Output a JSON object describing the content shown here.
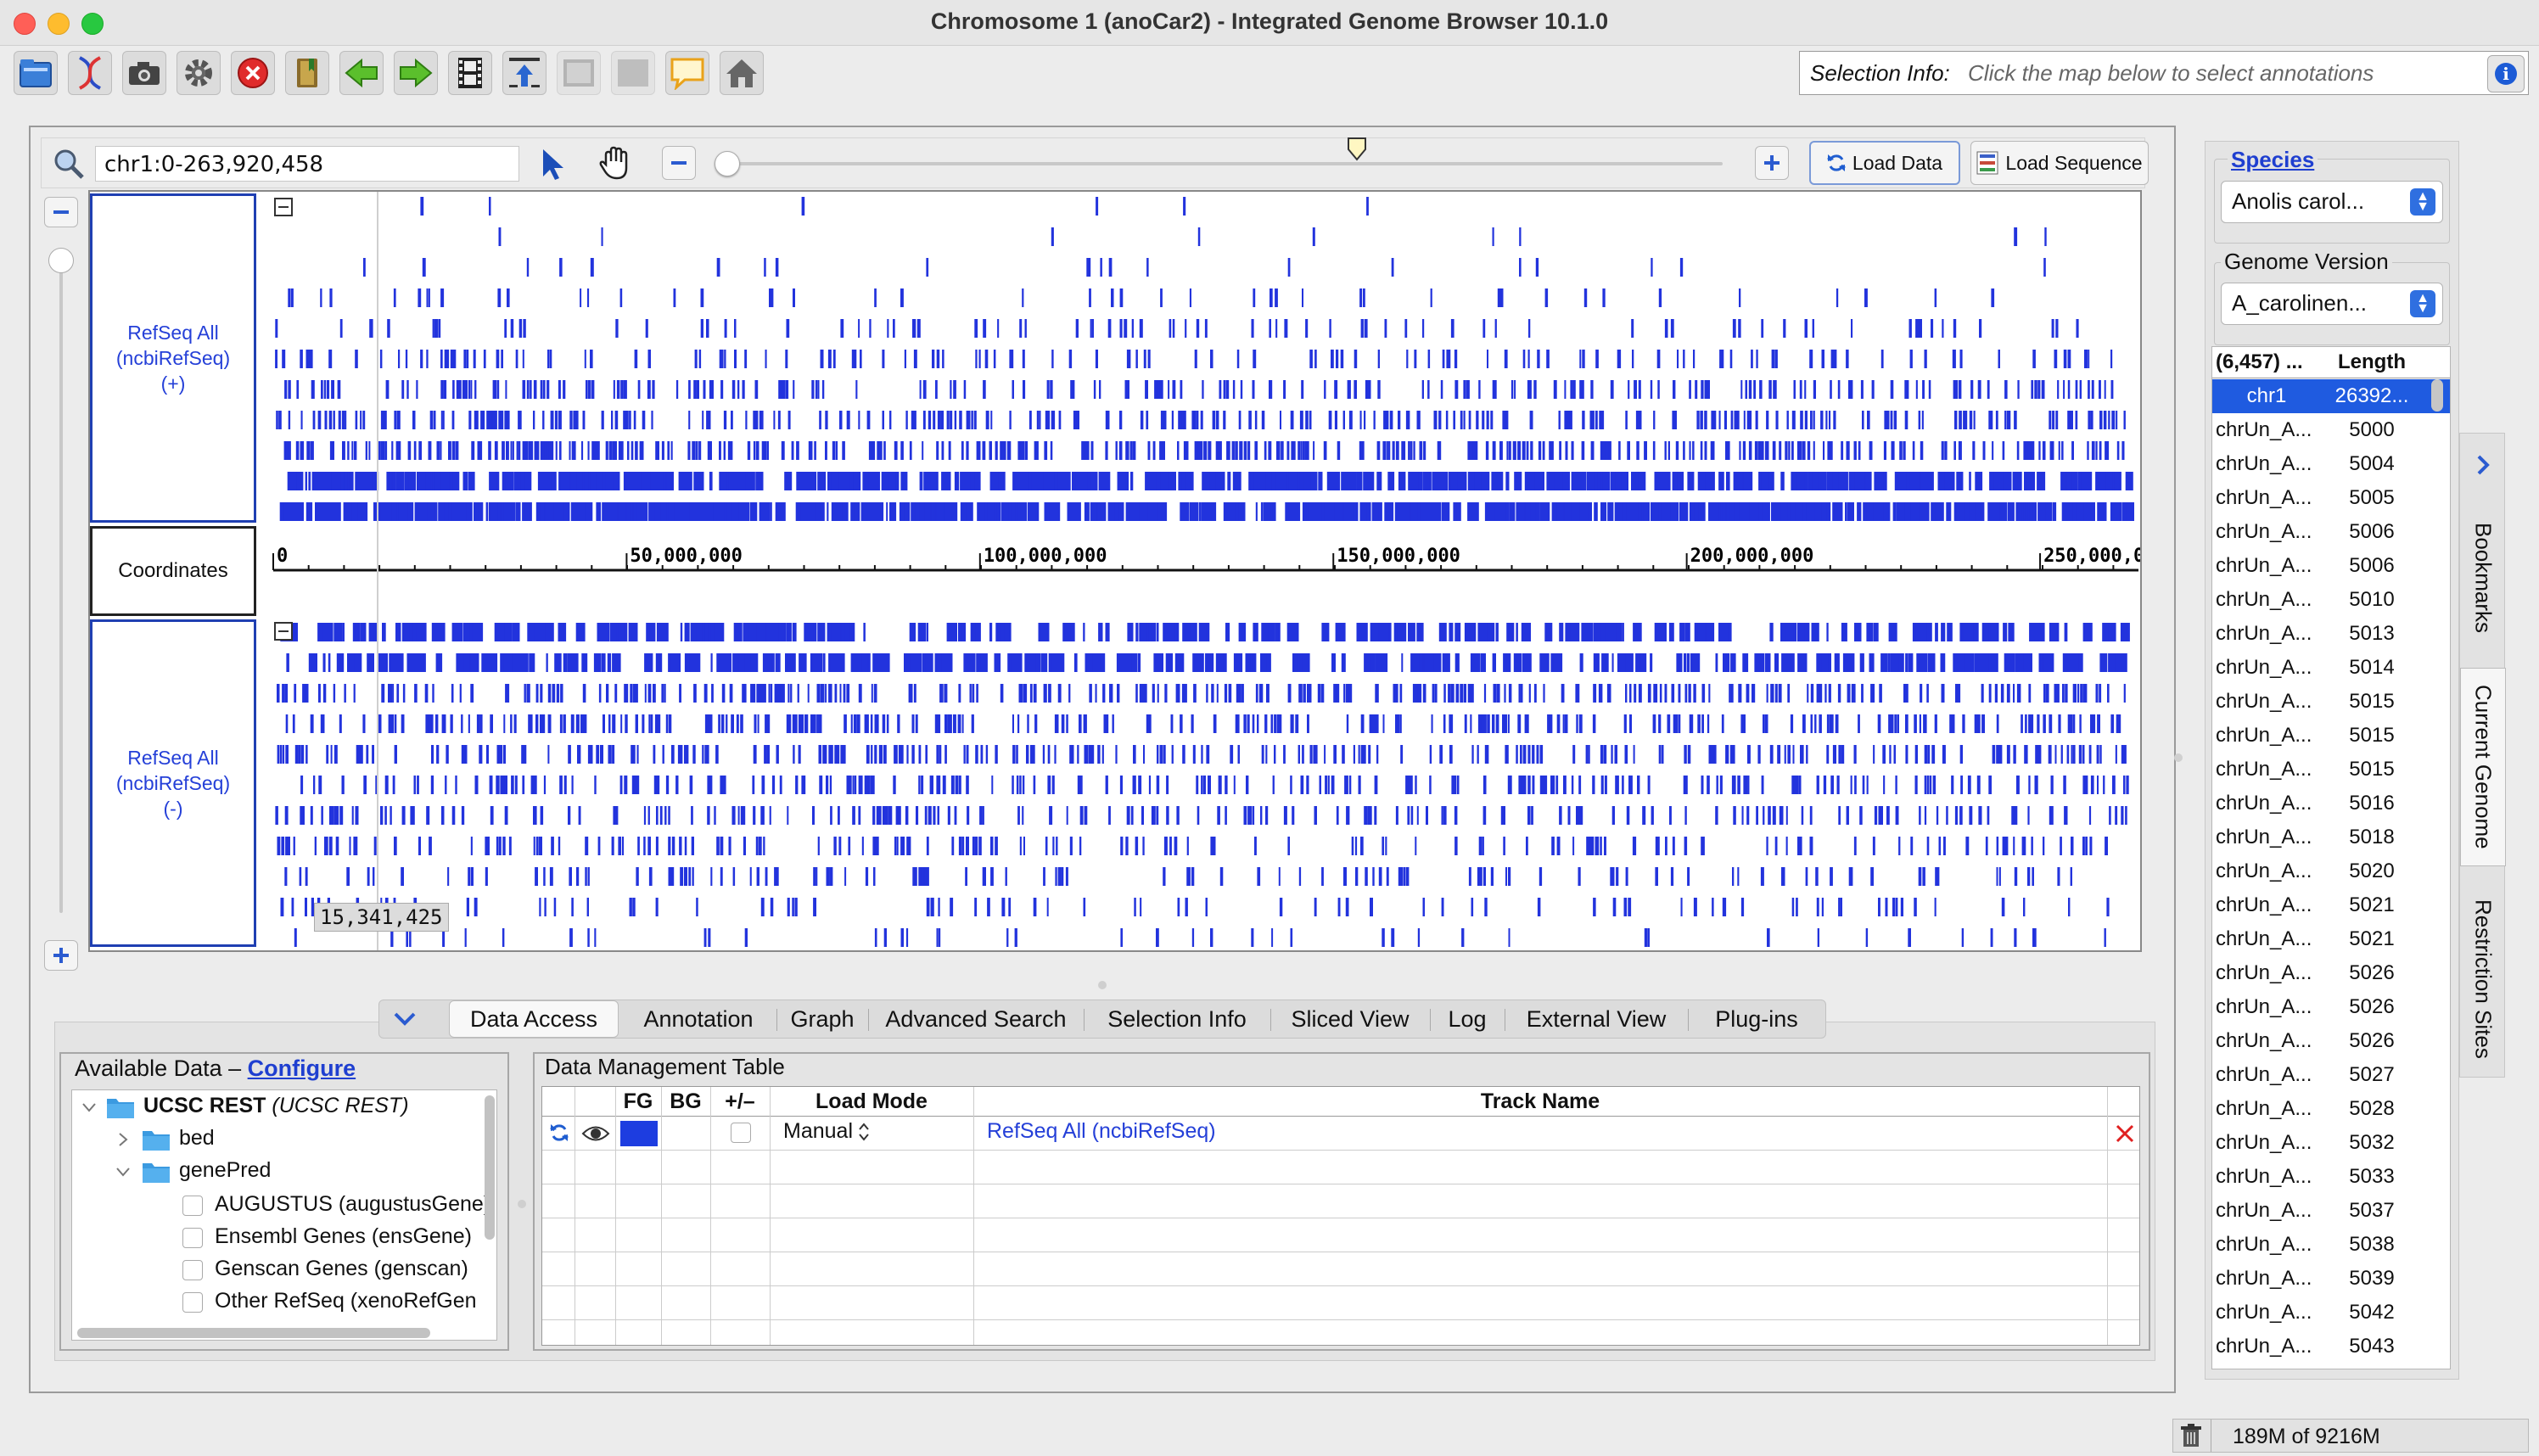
{
  "window": {
    "title": "Chromosome 1  (anoCar2) - Integrated Genome Browser 10.1.0"
  },
  "toolbar": {
    "icons": [
      "open-file-icon",
      "dna-icon",
      "camera-icon",
      "gear-icon",
      "stop-icon",
      "bookmark-book-icon",
      "back-arrow-icon",
      "forward-arrow-icon",
      "film-icon",
      "upload-icon",
      "view-icon",
      "grid-icon",
      "comment-icon",
      "home-icon"
    ]
  },
  "selection_info": {
    "label": "Selection Info:",
    "hint": "Click the map below to select annotations",
    "info_glyph": "i"
  },
  "navigation": {
    "location": "chr1:0-263,920,458",
    "load_data_label": "Load Data",
    "load_sequence_label": "Load Sequence",
    "zoom_slider_fraction": 0.0
  },
  "tracks": {
    "plus_label_line1": "RefSeq All",
    "plus_label_line2": "(ncbiRefSeq)",
    "plus_label_line3": "(+)",
    "coordinates_label": "Coordinates",
    "minus_label_line1": "RefSeq All",
    "minus_label_line2": "(ncbiRefSeq)",
    "minus_label_line3": "(-)",
    "ruler_ticks": [
      "0",
      "50,000,000",
      "100,000,000",
      "150,000,000",
      "200,000,000",
      "250,000,0"
    ],
    "hover_coordinate": "15,341,425",
    "feature_color": "#2233dd"
  },
  "tabs": {
    "items": [
      "Data Access",
      "Annotation",
      "Graph",
      "Advanced Search",
      "Selection Info",
      "Sliced View",
      "Log",
      "External View",
      "Plug-ins"
    ],
    "active": "Data Access"
  },
  "available_data": {
    "title": "Available Data – ",
    "configure_link": "Configure",
    "root_label": "UCSC REST",
    "root_sublabel": "(UCSC REST)",
    "folders": [
      "bed",
      "genePred"
    ],
    "items": [
      "AUGUSTUS (augustusGene)",
      "Ensembl Genes (ensGene)",
      "Genscan Genes (genscan)",
      "Other RefSeq (xenoRefGen"
    ]
  },
  "data_management": {
    "title": "Data Management Table",
    "headers": [
      "FG",
      "BG",
      "+/–",
      "Load Mode",
      "Track Name"
    ],
    "row": {
      "load_mode": "Manual",
      "track_name": "RefSeq All (ncbiRefSeq)",
      "fg_color": "#1d3de0"
    }
  },
  "species_panel": {
    "species_label": "Species",
    "species_value": "Anolis carol...",
    "genome_version_label": "Genome Version",
    "genome_version_value": "A_carolinen..."
  },
  "sequence_table": {
    "header_name": "(6,457) ...",
    "header_length": "Length",
    "rows": [
      {
        "name": "chr1",
        "length": "26392..."
      },
      {
        "name": "chrUn_A...",
        "length": "5000"
      },
      {
        "name": "chrUn_A...",
        "length": "5004"
      },
      {
        "name": "chrUn_A...",
        "length": "5005"
      },
      {
        "name": "chrUn_A...",
        "length": "5006"
      },
      {
        "name": "chrUn_A...",
        "length": "5006"
      },
      {
        "name": "chrUn_A...",
        "length": "5010"
      },
      {
        "name": "chrUn_A...",
        "length": "5013"
      },
      {
        "name": "chrUn_A...",
        "length": "5014"
      },
      {
        "name": "chrUn_A...",
        "length": "5015"
      },
      {
        "name": "chrUn_A...",
        "length": "5015"
      },
      {
        "name": "chrUn_A...",
        "length": "5015"
      },
      {
        "name": "chrUn_A...",
        "length": "5016"
      },
      {
        "name": "chrUn_A...",
        "length": "5018"
      },
      {
        "name": "chrUn_A...",
        "length": "5020"
      },
      {
        "name": "chrUn_A...",
        "length": "5021"
      },
      {
        "name": "chrUn_A...",
        "length": "5021"
      },
      {
        "name": "chrUn_A...",
        "length": "5026"
      },
      {
        "name": "chrUn_A...",
        "length": "5026"
      },
      {
        "name": "chrUn_A...",
        "length": "5026"
      },
      {
        "name": "chrUn_A...",
        "length": "5027"
      },
      {
        "name": "chrUn_A...",
        "length": "5028"
      },
      {
        "name": "chrUn_A...",
        "length": "5032"
      },
      {
        "name": "chrUn_A...",
        "length": "5033"
      },
      {
        "name": "chrUn_A...",
        "length": "5037"
      },
      {
        "name": "chrUn_A...",
        "length": "5038"
      },
      {
        "name": "chrUn_A...",
        "length": "5039"
      },
      {
        "name": "chrUn_A...",
        "length": "5042"
      },
      {
        "name": "chrUn_A...",
        "length": "5043"
      }
    ]
  },
  "side_tabs": [
    "Bookmarks",
    "Current Genome",
    "Restriction Sites"
  ],
  "status": {
    "memory": "189M of 9216M"
  }
}
